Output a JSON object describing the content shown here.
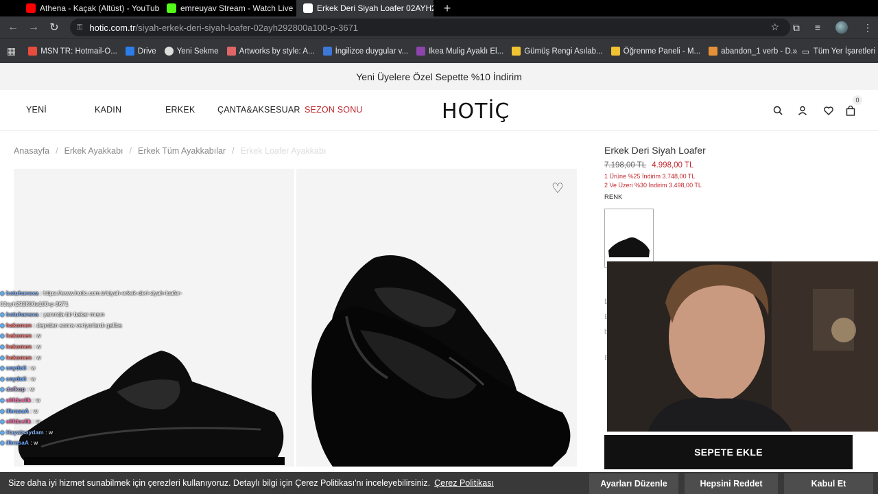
{
  "browser": {
    "tabs": [
      {
        "title": "Athena - Kaçak (Altüst) - YouTube",
        "favicon_color": "#ff0000"
      },
      {
        "title": "emreuyav Stream - Watch Live",
        "favicon_color": "#53fc18"
      },
      {
        "title": "Erkek Deri Siyah Loafer 02AYH2...",
        "favicon_color": "#ffffff"
      }
    ],
    "url_host": "hotic.com.tr",
    "url_path": "/siyah-erkek-deri-siyah-loafer-02ayh292800a100-p-3671",
    "bookmarks": [
      {
        "label": "MSN TR: Hotmail-O...",
        "color": "#e74c3c"
      },
      {
        "label": "Drive",
        "color": "#2b7de9"
      },
      {
        "label": "Yeni Sekme",
        "color": "#dddddd"
      },
      {
        "label": "Artworks by style: A...",
        "color": "#e06666"
      },
      {
        "label": "İngilizce duygular v...",
        "color": "#3c78d8"
      },
      {
        "label": "Ikea Mulig Ayaklı El...",
        "color": "#8e44ad"
      },
      {
        "label": "Gümüş Rengi Asılab...",
        "color": "#f1c232"
      },
      {
        "label": "Öğrenme Paneli - M...",
        "color": "#f1c232"
      },
      {
        "label": "abandon_1 verb - D...",
        "color": "#e69138"
      }
    ],
    "bookmarks_more": "»",
    "bookmarks_folder": "Tüm Yer İşaretleri"
  },
  "promo": "Yeni Üyelere Özel Sepette %10 İndirim",
  "nav": {
    "items": [
      "YENİ",
      "KADIN",
      "ERKEK",
      "ÇANTA&AKSESUAR"
    ],
    "sale": "SEZON SONU",
    "logo": "HOTİÇ",
    "cart_count": "0"
  },
  "breadcrumb": [
    "Anasayfa",
    "Erkek Ayakkabı",
    "Erkek Tüm Ayakkabılar",
    "Erkek Loafer Ayakkabı"
  ],
  "product": {
    "title": "Erkek Deri Siyah Loafer",
    "old_price": "7.198,00 TL",
    "new_price": "4.998,00 TL",
    "discount_1": "1 Ürüne %25 İndirim 3.748,00 TL",
    "discount_2": "2 Ve Üzeri %30 İndirim 3.498,00 TL",
    "color_label": "RENK",
    "add_to_cart": "SEPETE EKLE"
  },
  "chat": [
    {
      "user": "batuhansxa",
      "msg": ": https://www.hotic.com.tr/siyah-erkek-deri-siyah-loafer-",
      "color": "#8ab4f8"
    },
    {
      "user": "",
      "msg": "02ayh292800a100-p-3671",
      "color": "#ffffff"
    },
    {
      "user": "batuhansxa",
      "msg": ": yanında bir bakar mısın",
      "color": "#8ab4f8"
    },
    {
      "user": "hakomen",
      "msg": ": deprdan sonra veriyorlardı galiba",
      "color": "#ff7a7a"
    },
    {
      "user": "hakomen",
      "msg": ": w",
      "color": "#ff7a7a"
    },
    {
      "user": "hakomen",
      "msg": ": w",
      "color": "#ff7a7a"
    },
    {
      "user": "hakomen",
      "msg": ": w",
      "color": "#ff7a7a"
    },
    {
      "user": "ceydoii",
      "msg": ": w",
      "color": "#6fa8ff"
    },
    {
      "user": "ceydoii",
      "msg": ": w",
      "color": "#6fa8ff"
    },
    {
      "user": "dafkop",
      "msg": ": w",
      "color": "#b4a7d6"
    },
    {
      "user": "elifdcelik",
      "msg": ": w",
      "color": "#ff6fb0"
    },
    {
      "user": "ilkrasaA",
      "msg": ": w",
      "color": "#6fa8ff"
    },
    {
      "user": "elifdcelik",
      "msg": ": w",
      "color": "#ff6fb0"
    },
    {
      "user": "Hayatsaydam",
      "msg": ": w",
      "color": "#8ab4f8"
    },
    {
      "user": "ilkrasaA",
      "msg": ": w",
      "color": "#6fa8ff"
    }
  ],
  "cookie": {
    "text": "Size daha iyi hizmet sunabilmek için çerezleri kullanıyoruz. Detaylı bilgi için Çerez Politikası'nı inceleyebilirsiniz.",
    "link": "Çerez Politikası",
    "settings": "Ayarları Düzenle",
    "reject": "Hepsini Reddet",
    "accept": "Kabul Et"
  }
}
